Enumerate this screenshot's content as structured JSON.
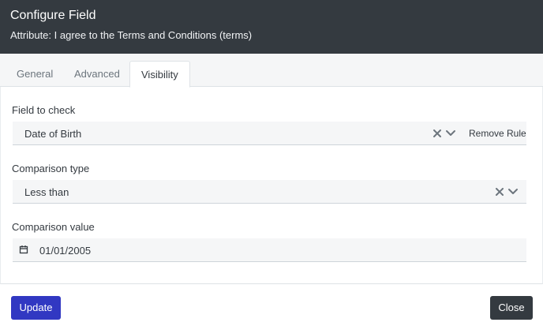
{
  "header": {
    "title": "Configure Field",
    "subtitle": "Attribute: I agree to the Terms and Conditions (terms)"
  },
  "tabs": [
    {
      "label": "General",
      "active": false
    },
    {
      "label": "Advanced",
      "active": false
    },
    {
      "label": "Visibility",
      "active": true
    }
  ],
  "form": {
    "field_to_check": {
      "label": "Field to check",
      "value": "Date of Birth",
      "remove_rule_label": "Remove Rule",
      "clear_icon": "close-icon",
      "dropdown_icon": "chevron-down-icon"
    },
    "comparison_type": {
      "label": "Comparison type",
      "value": "Less than",
      "clear_icon": "close-icon",
      "dropdown_icon": "chevron-down-icon"
    },
    "comparison_value": {
      "label": "Comparison value",
      "value": "01/01/2005",
      "icon": "calendar-icon"
    }
  },
  "footer": {
    "update_label": "Update",
    "close_label": "Close"
  },
  "colors": {
    "header_bg": "#343a40",
    "primary": "#3138c2",
    "dark": "#343a40",
    "field_bg": "#f5f6f7"
  }
}
